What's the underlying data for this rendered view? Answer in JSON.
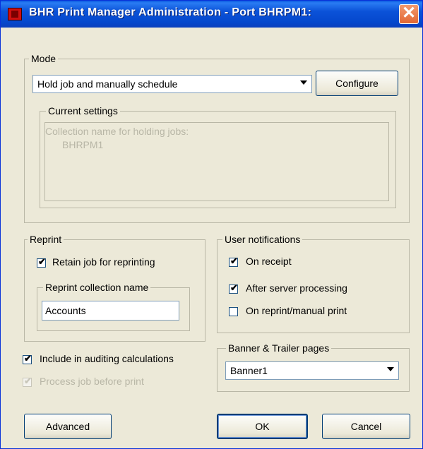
{
  "window": {
    "title": "BHR Print Manager Administration - Port BHRPM1:",
    "close_glyph": "✕"
  },
  "mode": {
    "label": "Mode",
    "selected": "Hold job and manually schedule",
    "configure_label": "Configure",
    "current_settings": {
      "label": "Current settings",
      "line1": "Collection name for holding jobs:",
      "line2": "BHRPM1"
    }
  },
  "reprint": {
    "label": "Reprint",
    "retain_label": "Retain job for reprinting",
    "retain_checked": true,
    "collection": {
      "label": "Reprint collection name",
      "value": "Accounts"
    }
  },
  "notifications": {
    "label": "User notifications",
    "items": [
      {
        "label": "On receipt",
        "checked": true
      },
      {
        "label": "After server processing",
        "checked": true
      },
      {
        "label": "On reprint/manual print",
        "checked": false
      }
    ]
  },
  "auditing": {
    "label": "Include in auditing calculations",
    "checked": true
  },
  "process": {
    "label": "Process job before print",
    "checked": true,
    "disabled": true
  },
  "banner": {
    "label": "Banner & Trailer pages",
    "selected": "Banner1"
  },
  "buttons": {
    "advanced": "Advanced",
    "ok": "OK",
    "cancel": "Cancel"
  },
  "check_glyph": "✔"
}
